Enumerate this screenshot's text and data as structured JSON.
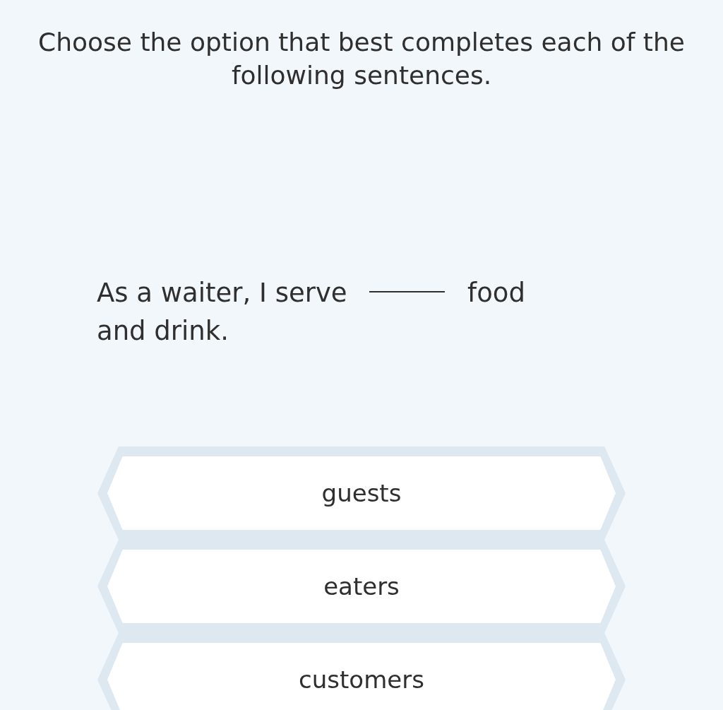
{
  "instruction": "Choose the option that best completes each of the following sentences.",
  "question": {
    "before": "As a waiter, I serve",
    "after": "food and drink."
  },
  "options": [
    {
      "label": "guests",
      "selected": false
    },
    {
      "label": "eaters",
      "selected": false
    },
    {
      "label": "customers",
      "selected": false
    }
  ]
}
